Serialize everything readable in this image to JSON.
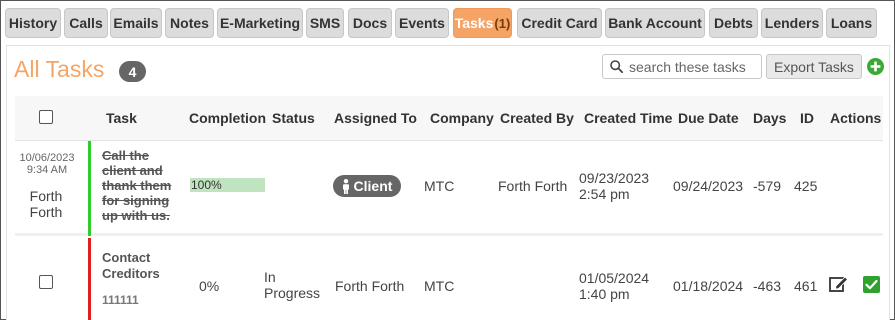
{
  "tabs": [
    {
      "label": "History"
    },
    {
      "label": "Calls"
    },
    {
      "label": "Emails"
    },
    {
      "label": "Notes"
    },
    {
      "label": "E-Marketing"
    },
    {
      "label": "SMS"
    },
    {
      "label": "Docs"
    },
    {
      "label": "Events"
    },
    {
      "label": "Tasks",
      "count": "(1)",
      "active": true
    },
    {
      "label": "Credit Card"
    },
    {
      "label": "Bank Account"
    },
    {
      "label": "Debts"
    },
    {
      "label": "Lenders"
    },
    {
      "label": "Loans"
    }
  ],
  "header": {
    "title": "All Tasks",
    "count": "4",
    "search_placeholder": "search these tasks",
    "export_label": "Export Tasks"
  },
  "columns": [
    "Task",
    "Completion",
    "Status",
    "Assigned To",
    "Company",
    "Created By",
    "Created Time",
    "Due Date",
    "Days",
    "ID",
    "Actions"
  ],
  "rows": [
    {
      "date": "10/06/2023",
      "time": "9:34 AM",
      "owner": "Forth Forth",
      "task": "Call the client and thank them for signing up with us.",
      "completed": true,
      "completion": "100%",
      "assigned_to": "Client",
      "company": "MTC",
      "created_by": "Forth Forth",
      "created_date": "09/23/2023",
      "created_time": "2:54 pm",
      "due_date": "09/24/2023",
      "days": "-579",
      "id": "425",
      "status_color": "#2ecc2e"
    },
    {
      "task": "Contact Creditors",
      "task_sub": "111111",
      "completed": false,
      "completion": "0%",
      "status": "In Progress",
      "assigned_to": "Forth Forth",
      "company": "MTC",
      "created_date": "01/05/2024",
      "created_time": "1:40 pm",
      "due_date": "01/18/2024",
      "days": "-463",
      "id": "461",
      "status_color": "#e02020"
    }
  ],
  "colors": {
    "accent": "#f5a465",
    "done": "#2ecc2e",
    "overdue": "#e02020",
    "badge": "#666666"
  }
}
